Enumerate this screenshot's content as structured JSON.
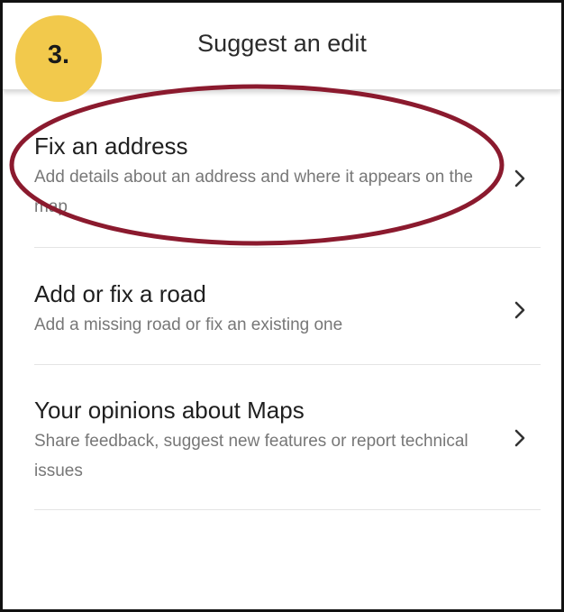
{
  "step": {
    "label": "3."
  },
  "header": {
    "title": "Suggest an edit"
  },
  "items": [
    {
      "title": "Fix an address",
      "description": "Add details about an address and where it appears on the map"
    },
    {
      "title": "Add or fix a road",
      "description": "Add a missing road or fix an existing one"
    },
    {
      "title": "Your opinions about Maps",
      "description": "Share feedback, suggest new features or report technical issues"
    }
  ],
  "colors": {
    "badge": "#f2c94c",
    "highlight_ring": "#8b1a2e",
    "title_text": "#1f1f1f",
    "description_text": "#777777"
  },
  "icons": {
    "item_arrow": "chevron-right-icon"
  }
}
